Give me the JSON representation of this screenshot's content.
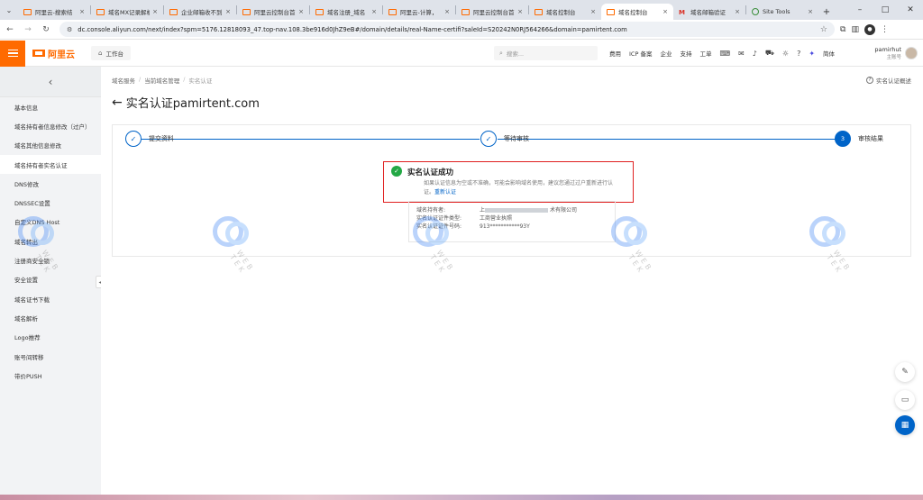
{
  "browser": {
    "tabs": [
      {
        "title": "阿里云-搜索结",
        "favicon": "aliyun"
      },
      {
        "title": "域名MX记录解析",
        "favicon": "aliyun"
      },
      {
        "title": "企业邮箱收不到",
        "favicon": "aliyun"
      },
      {
        "title": "阿里云控制台首页",
        "favicon": "aliyun"
      },
      {
        "title": "域名注册_域名",
        "favicon": "aliyun"
      },
      {
        "title": "阿里云-计算，",
        "favicon": "aliyun"
      },
      {
        "title": "阿里云控制台首页",
        "favicon": "aliyun"
      },
      {
        "title": "域名控制台",
        "favicon": "aliyun"
      },
      {
        "title": "域名控制台",
        "favicon": "aliyun",
        "active": true
      },
      {
        "title": "域名邮箱验证",
        "favicon": "gmail"
      },
      {
        "title": "Site Tools",
        "favicon": "sitetools"
      }
    ],
    "close_glyph": "×",
    "new_tab_glyph": "+",
    "url": "dc.console.aliyun.com/next/index?spm=5176.12818093_47.top-nav.108.3be916d0JhZ9eB#/domain/details/real-Name-certifi?saleId=S20242N0RJ564266&domain=pamirtent.com"
  },
  "console": {
    "logo_text": "阿里云",
    "workbench_label": "工作台",
    "search_placeholder": "搜索...",
    "menu": [
      "费用",
      "ICP 备案",
      "企业",
      "支持",
      "工单"
    ],
    "lang_label": "简体",
    "user_name": "pamirhut",
    "user_role": "主账号"
  },
  "sidebar": {
    "back_glyph": "‹",
    "items": [
      {
        "label": "基本信息"
      },
      {
        "label": "域名持有者信息修改（过户）"
      },
      {
        "label": "域名其他信息修改"
      },
      {
        "label": "域名持有者实名认证",
        "active": true
      },
      {
        "label": "DNS修改"
      },
      {
        "label": "DNSSEC设置"
      },
      {
        "label": "自定义DNS Host"
      },
      {
        "label": "域名转出"
      },
      {
        "label": "注册商安全锁"
      },
      {
        "label": "安全设置"
      },
      {
        "label": "域名证书下载"
      },
      {
        "label": "域名解析"
      },
      {
        "label": "Logo推荐"
      },
      {
        "label": "账号间转移"
      },
      {
        "label": "带价PUSH"
      }
    ]
  },
  "main": {
    "breadcrumb": [
      "域名服务",
      "当前域名管理",
      "实名认证"
    ],
    "overview_link": "实名认证概述",
    "title": "实名认证pamirtent.com",
    "steps": [
      {
        "label": "提交资料",
        "state": "done"
      },
      {
        "label": "等待审核",
        "state": "done"
      },
      {
        "label": "审核结果",
        "state": "current",
        "number": "3"
      }
    ],
    "result": {
      "title": "实名认证成功",
      "desc": "如果认证信息为空或不准确，可能会影响域名使用，建议您通过过户重新进行认证。",
      "link": "重新认证"
    },
    "info": [
      {
        "key": "域名持有者:",
        "value_prefix": "上",
        "value_suffix": "术有限公司"
      },
      {
        "key": "实名认证证件类型:",
        "value": "工商营业执照"
      },
      {
        "key": "实名认证证件号码:",
        "value": "913***********93Y"
      }
    ]
  },
  "watermark_text": "WEB TEK",
  "colors": {
    "brand_orange": "#ff6a00",
    "primary_blue": "#0064c8",
    "success_green": "#23a845",
    "highlight_red": "#e02020"
  }
}
